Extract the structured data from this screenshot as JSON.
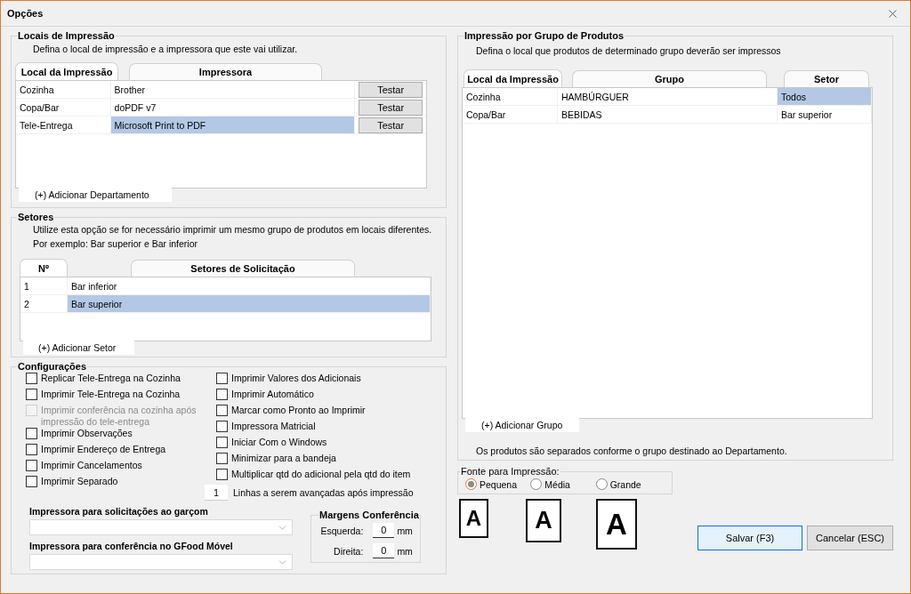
{
  "window": {
    "title": "Opções"
  },
  "printing_locations": {
    "title": "Locais de Impressão",
    "description": "Defina o local de impressão e a impressora que este vai utilizar.",
    "columns": [
      "Local da Impressão",
      "Impressora"
    ],
    "rows": [
      {
        "cells": [
          {
            "text": "Cozinha",
            "selected": false
          },
          {
            "text": "Brother",
            "selected": false
          }
        ],
        "button": "Testar"
      },
      {
        "cells": [
          {
            "text": "Copa/Bar",
            "selected": false
          },
          {
            "text": "doPDF v7",
            "selected": false
          }
        ],
        "button": "Testar"
      },
      {
        "cells": [
          {
            "text": "Tele-Entrega",
            "selected": false
          },
          {
            "text": "Microsoft Print to PDF",
            "selected": true
          }
        ],
        "button": "Testar"
      }
    ],
    "add_link": "(+) Adicionar Departamento"
  },
  "sectors": {
    "title": "Setores",
    "description": [
      "Utilize esta opção se for necessário imprimir um mesmo grupo de produtos em locais diferentes.",
      "Por exemplo: Bar superior e Bar inferior"
    ],
    "columns": [
      "Nº",
      "Setores de Solicitação"
    ],
    "rows": [
      {
        "cells": [
          {
            "text": "1",
            "selected": false
          },
          {
            "text": "Bar inferior",
            "selected": false
          }
        ]
      },
      {
        "cells": [
          {
            "text": "2",
            "selected": false
          },
          {
            "text": "Bar superior",
            "selected": true
          }
        ]
      }
    ],
    "add_link": "(+) Adicionar Setor"
  },
  "settings": {
    "title": "Configurações",
    "left_options": [
      {
        "label": "Replicar Tele-Entrega na Cozinha",
        "checked": false,
        "disabled": false
      },
      {
        "label": "Imprimir Tele-Entrega na Cozinha",
        "checked": false,
        "disabled": false
      },
      {
        "label": "Imprimir conferência na cozinha após impressão do tele-entrega",
        "checked": false,
        "disabled": true
      },
      {
        "label": "Imprimir Observações",
        "checked": false,
        "disabled": false
      },
      {
        "label": "Imprimir Endereço de Entrega",
        "checked": false,
        "disabled": false
      },
      {
        "label": "Imprimir Cancelamentos",
        "checked": false,
        "disabled": false
      },
      {
        "label": "Imprimir Separado",
        "checked": false,
        "disabled": false
      }
    ],
    "right_options": [
      {
        "label": "Imprimir Valores dos Adicionais",
        "checked": false,
        "disabled": false
      },
      {
        "label": "Imprimir Automático",
        "checked": false,
        "disabled": false
      },
      {
        "label": "Marcar como Pronto ao Imprimir",
        "checked": false,
        "disabled": false
      },
      {
        "label": "Impressora Matricial",
        "checked": false,
        "disabled": false
      },
      {
        "label": "Iniciar Com o Windows",
        "checked": false,
        "disabled": false
      },
      {
        "label": "Minimizar para a bandeja",
        "checked": false,
        "disabled": false
      },
      {
        "label": "Multiplicar qtd do adicional pela qtd do item",
        "checked": false,
        "disabled": false
      }
    ],
    "line_advance": {
      "value": "1",
      "label": "Linhas a serem avançadas após impressão"
    },
    "dropdowns": [
      {
        "label": "Impressora para solicitações ao garçom"
      },
      {
        "label": "Impressora para conferência no GFood Móvel"
      }
    ],
    "margins": {
      "title": "Margens Conferência",
      "fields": [
        {
          "label": "Esquerda:",
          "value": "0",
          "unit": "mm"
        },
        {
          "label": "Direita:",
          "value": "0",
          "unit": "mm"
        }
      ]
    }
  },
  "product_groups": {
    "title": "Impressão por Grupo de Produtos",
    "description": "Defina o local que produtos de determinado grupo deverão ser impressos",
    "columns": [
      "Local da Impressão",
      "Grupo",
      "Setor"
    ],
    "rows": [
      {
        "cells": [
          {
            "text": "Cozinha",
            "selected": false
          },
          {
            "text": "HAMBÚRGUER",
            "selected": false
          },
          {
            "text": "Todos",
            "selected": true
          }
        ]
      },
      {
        "cells": [
          {
            "text": "Copa/Bar",
            "selected": false
          },
          {
            "text": "BEBIDAS",
            "selected": false
          },
          {
            "text": "Bar superior",
            "selected": false
          }
        ]
      }
    ],
    "add_link": "(+) Adicionar Grupo",
    "footnote": "Os produtos são separados conforme o grupo destinado ao Departamento."
  },
  "font": {
    "title": "Fonte para Impressão:",
    "options": [
      {
        "label": "Pequena",
        "selected": true,
        "preview": "A"
      },
      {
        "label": "Média",
        "selected": false,
        "preview": "A"
      },
      {
        "label": "Grande",
        "selected": false,
        "preview": "A"
      }
    ]
  },
  "buttons": [
    {
      "label": "Salvar (F3)",
      "kind": "primary"
    },
    {
      "label": "Cancelar (ESC)",
      "kind": "secondary"
    }
  ]
}
